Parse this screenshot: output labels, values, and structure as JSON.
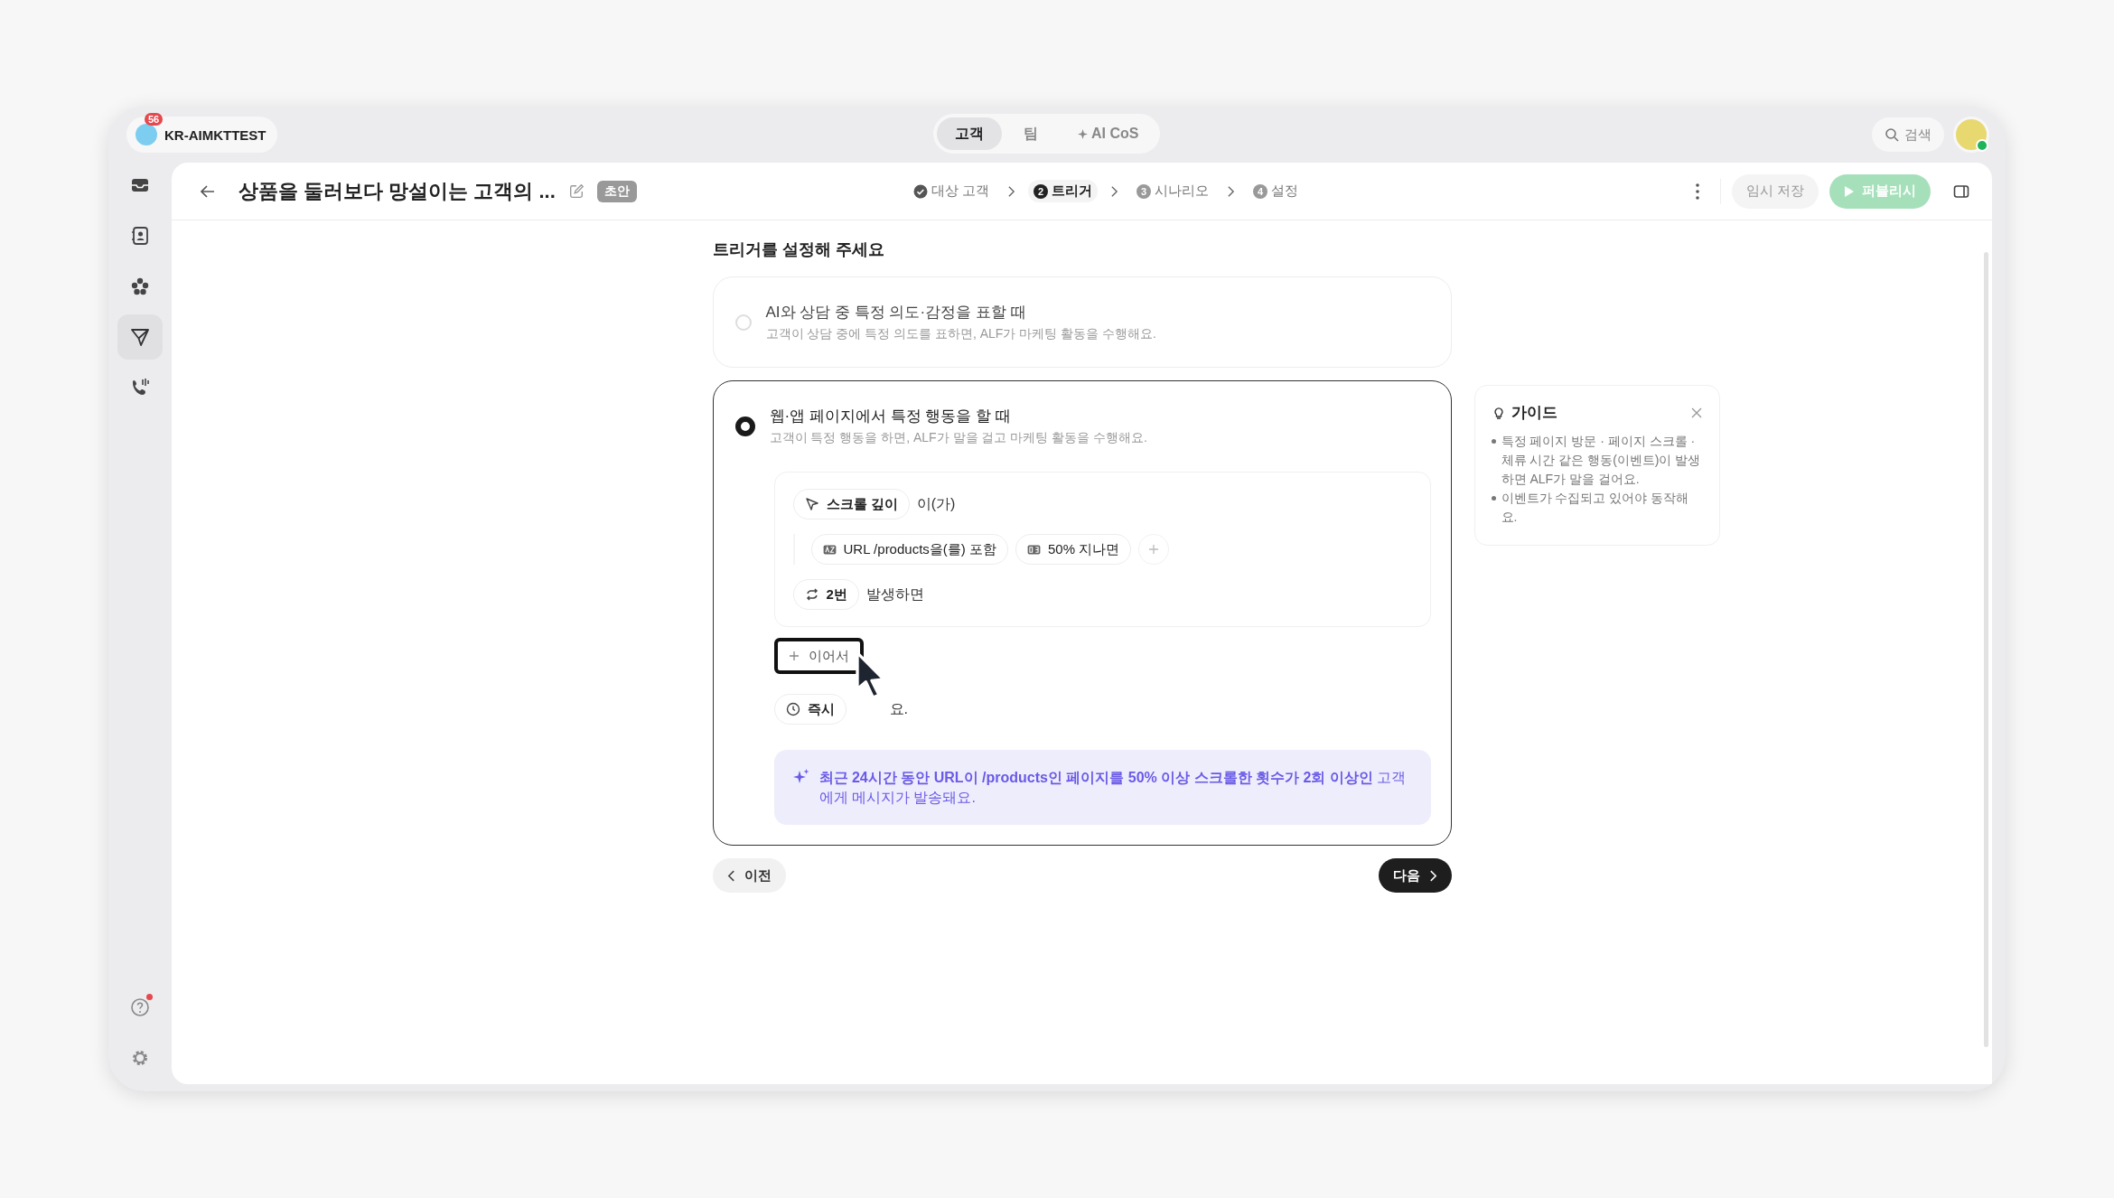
{
  "workspace": {
    "name": "KR-AIMKTTEST",
    "badge": "56"
  },
  "top_tabs": [
    {
      "label": "고객",
      "selected": true
    },
    {
      "label": "팀",
      "selected": false
    },
    {
      "label": "AI CoS",
      "selected": false
    }
  ],
  "search": {
    "placeholder": "검색"
  },
  "user": {
    "online": true
  },
  "sidebar": {
    "items": [
      {
        "kind": "inbox",
        "selected": false
      },
      {
        "kind": "contacts",
        "selected": false
      },
      {
        "kind": "flower",
        "selected": false
      },
      {
        "kind": "send",
        "selected": true
      },
      {
        "kind": "call",
        "selected": false
      }
    ],
    "bottom_items": [
      {
        "kind": "help",
        "selected": false,
        "notification": true
      },
      {
        "kind": "settings",
        "selected": false,
        "notification": false
      }
    ]
  },
  "header": {
    "title": "상품을 둘러보다 망설이는 고객의 ...",
    "status": "초안",
    "steps": [
      {
        "label": "대상 고객",
        "done": true,
        "selected": false
      },
      {
        "number": "2",
        "label": "트리거",
        "done": false,
        "selected": true
      },
      {
        "number": "3",
        "label": "시나리오",
        "done": false,
        "selected": false
      },
      {
        "number": "4",
        "label": "설정",
        "done": false,
        "selected": false
      }
    ],
    "save_button": "임시 저장",
    "publish_button": "퍼블리시"
  },
  "section_title": "트리거를 설정해 주세요",
  "options": [
    {
      "title": "AI와 상담 중 특정 의도·감정을 표할 때",
      "description": "고객이 상담 중에 특정 의도를 표하면, ALF가 마케팅 활동을 수행해요.",
      "selected": false
    },
    {
      "title": "웹·앱 페이지에서 특정 행동을 할 때",
      "description": "고객이 특정 행동을 하면, ALF가 말을 걸고 마케팅 활동을 수행해요.",
      "selected": true
    }
  ],
  "builder": {
    "event": "스크롤 깊이",
    "event_suffix": "이(가)",
    "filters": [
      {
        "kind": "text",
        "label": "URL /products을(를) 포함"
      },
      {
        "kind": "number",
        "label": "50% 지나면"
      }
    ],
    "count": "2번",
    "count_suffix": "발생하면",
    "add_button": "이어서",
    "timing": "즉시",
    "timing_suffix": "요.",
    "summary": "**최근 24시간 동안 URL이 /products인 페이지를 50% 이상 스크롤한 횟수가 2회 이상인** 고객에게 메시지가 발송돼요."
  },
  "nav": {
    "prev": "이전",
    "next": "다음"
  },
  "guide": {
    "title": "가이드",
    "bullets": [
      "특정 페이지 방문 · 페이지 스크롤 · 체류 시간 같은 행동(이벤트)이 발생하면 ALF가 말을 걸어요.",
      "이벤트가 수집되고 있어야 동작해요."
    ]
  }
}
